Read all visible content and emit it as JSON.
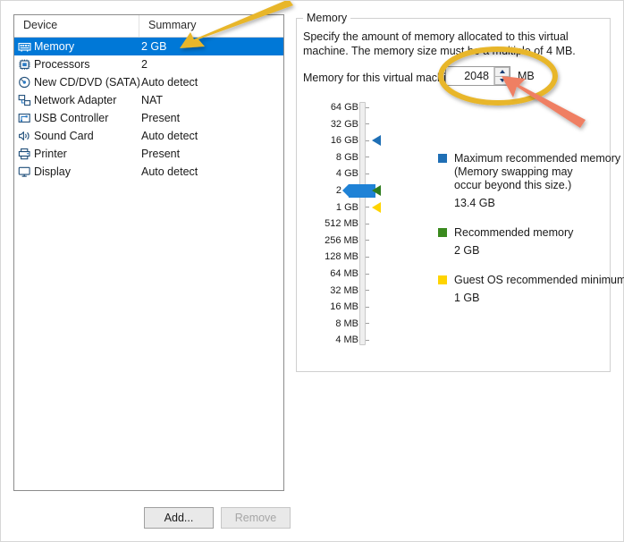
{
  "device_table": {
    "columns": [
      "Device",
      "Summary"
    ],
    "rows": [
      {
        "icon": "memory-icon",
        "name": "Memory",
        "summary": "2 GB",
        "selected": true
      },
      {
        "icon": "processor-icon",
        "name": "Processors",
        "summary": "2",
        "selected": false
      },
      {
        "icon": "cd-dvd-icon",
        "name": "New CD/DVD (SATA)",
        "summary": "Auto detect",
        "selected": false
      },
      {
        "icon": "network-adapter-icon",
        "name": "Network Adapter",
        "summary": "NAT",
        "selected": false
      },
      {
        "icon": "usb-controller-icon",
        "name": "USB Controller",
        "summary": "Present",
        "selected": false
      },
      {
        "icon": "sound-card-icon",
        "name": "Sound Card",
        "summary": "Auto detect",
        "selected": false
      },
      {
        "icon": "printer-icon",
        "name": "Printer",
        "summary": "Present",
        "selected": false
      },
      {
        "icon": "display-icon",
        "name": "Display",
        "summary": "Auto detect",
        "selected": false
      }
    ]
  },
  "buttons": {
    "add": "Add...",
    "remove": "Remove"
  },
  "memory_panel": {
    "group_title": "Memory",
    "description": "Specify the amount of memory allocated to this virtual machine. The memory size must be a multiple of 4 MB.",
    "field_label": "Memory for this virtual machine:",
    "value": "2048",
    "unit": "MB",
    "scale_labels": [
      "64 GB",
      "32 GB",
      "16 GB",
      "8 GB",
      "4 GB",
      "2 GB",
      "1 GB",
      "512 MB",
      "256 MB",
      "128 MB",
      "64 MB",
      "32 MB",
      "16 MB",
      "8 MB",
      "4 MB"
    ],
    "slider_value_label": "2 GB",
    "markers": [
      {
        "name": "maximum-recommended-marker",
        "label": "16 GB",
        "color": "#1f6fb5"
      },
      {
        "name": "recommended-marker",
        "label": "2 GB",
        "color": "#2f7d1e"
      },
      {
        "name": "guest-minimum-marker",
        "label": "1 GB",
        "color": "#ffd400"
      }
    ],
    "legend": [
      {
        "swatch_color": "#1f6fb5",
        "title": "Maximum recommended memory",
        "note_line1": "(Memory swapping may",
        "note_line2": "occur beyond this size.)",
        "value": "13.4 GB"
      },
      {
        "swatch_color": "#3a8a1e",
        "title": "Recommended memory",
        "note_line1": "",
        "note_line2": "",
        "value": "2 GB"
      },
      {
        "swatch_color": "#ffd400",
        "title": "Guest OS recommended minimum",
        "note_line1": "",
        "note_line2": "",
        "value": "1 GB"
      }
    ]
  },
  "annotations": {
    "arrow_yellow_color": "#e8b62c",
    "ellipse_yellow_color": "#e8b62c",
    "arrow_red_color": "#ef7f63"
  }
}
